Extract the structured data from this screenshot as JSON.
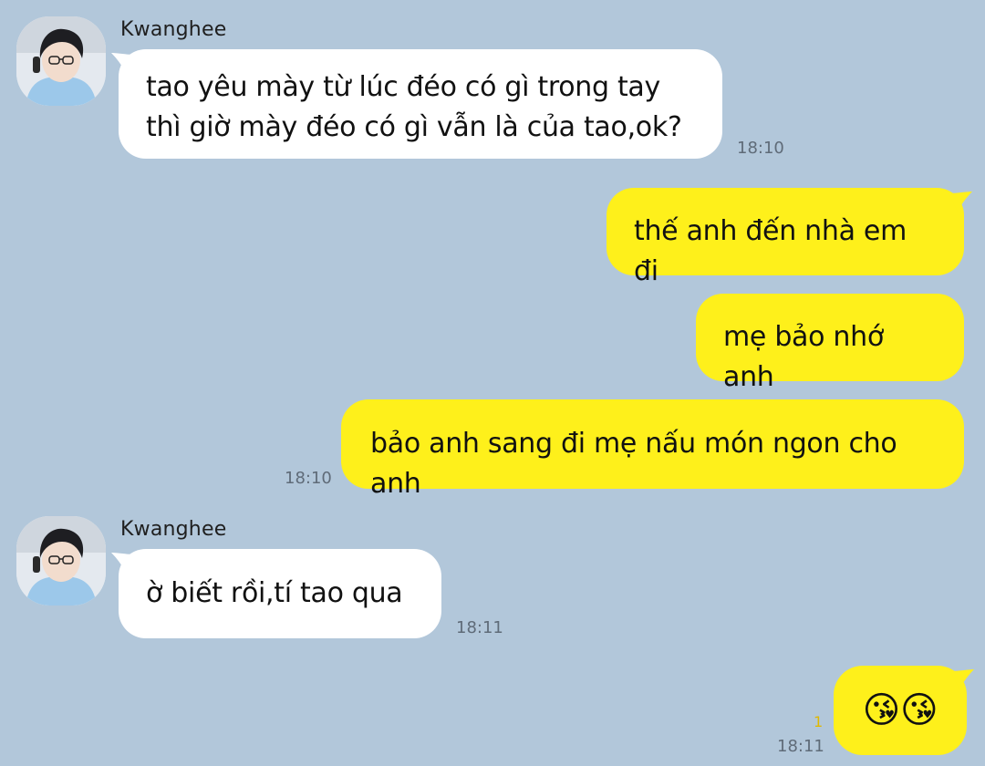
{
  "chat": {
    "colors": {
      "background": "#b2c7da",
      "incoming_bubble": "#ffffff",
      "outgoing_bubble": "#fef01b",
      "unread": "#e0b800"
    },
    "messages": [
      {
        "sender": "Kwanghee",
        "lines": [
          "tao yêu mày từ lúc đéo có gì trong tay",
          "thì giờ mày đéo có gì vẫn là của tao,ok?"
        ],
        "time": "18:10"
      },
      {
        "text": "thế anh đến nhà em đi"
      },
      {
        "text": "mẹ bảo nhớ anh"
      },
      {
        "text": "bảo anh sang đi mẹ nấu món ngon cho anh",
        "time": "18:10"
      },
      {
        "sender": "Kwanghee",
        "text": "ờ biết rồi,tí tao qua",
        "time": "18:11"
      },
      {
        "emoji": "😘😘",
        "emoji_icon": "kissing-face-with-heart-icon",
        "unread": "1",
        "time": "18:11"
      }
    ]
  }
}
